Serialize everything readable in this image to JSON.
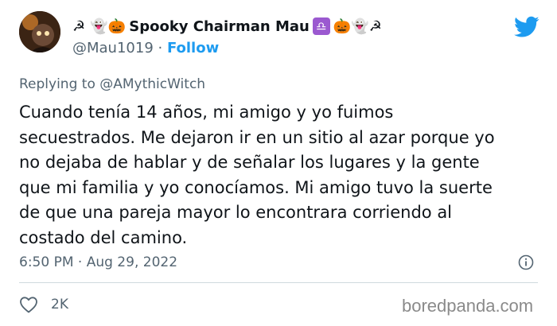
{
  "author": {
    "display_name_prefix": "☭ 👻🎃",
    "display_name": "Spooky Chairman Mau",
    "display_name_suffix_sign": "♎",
    "display_name_suffix": "🎃👻☭",
    "handle": "@Mau1019",
    "separator": " · ",
    "follow_label": "Follow"
  },
  "reply": {
    "prefix": "Replying to ",
    "mention": "@AMythicWitch"
  },
  "tweet": {
    "lines": [
      "Cuando tenía 14 años, mi amigo y yo fuimos",
      "secuestrados. Me dejaron ir en un sitio al azar porque yo",
      "no dejaba de hablar y de señalar los lugares y la gente",
      "que mi familia y yo conocíamos. Mi amigo tuvo la suerte",
      "de que una pareja mayor lo encontrara corriendo al",
      "costado del camino."
    ],
    "timestamp": "6:50 PM · Aug 29, 2022"
  },
  "actions": {
    "like_count": "2K"
  },
  "watermark": "boredpanda.com",
  "colors": {
    "accent": "#1d9bf0",
    "muted": "#536471",
    "text": "#0f1419",
    "divider": "#cfd9de"
  },
  "icons": {
    "brand": "twitter-bird-icon",
    "info": "info-icon",
    "like": "heart-icon"
  }
}
